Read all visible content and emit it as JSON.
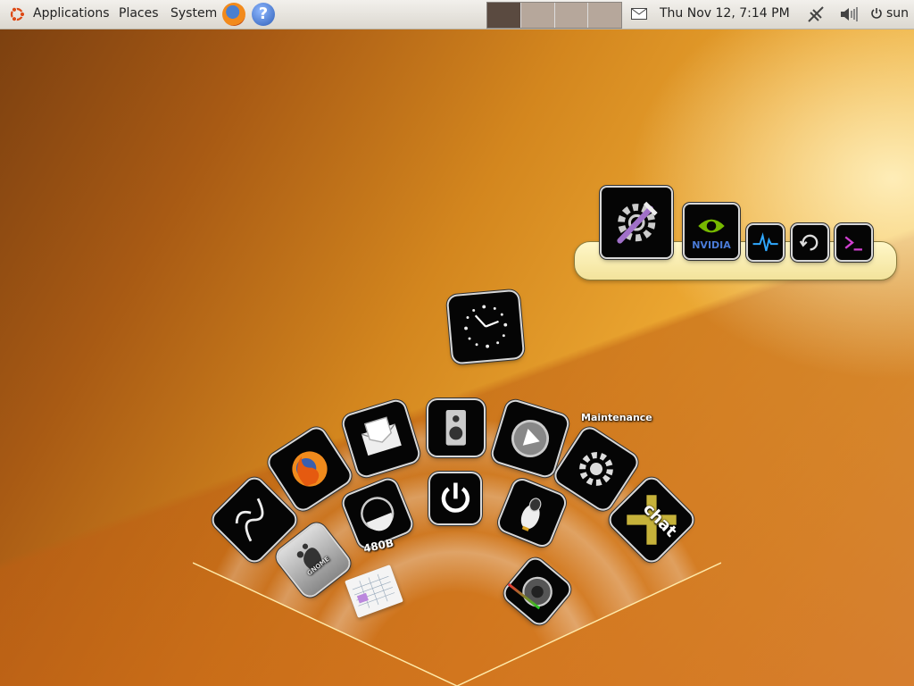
{
  "panel": {
    "menu": [
      "Applications",
      "Places",
      "System"
    ],
    "clock": "Thu Nov 12,  7:14 PM",
    "user": "sun",
    "workspace_count": 4,
    "active_workspace": 1
  },
  "dock": {
    "icons": [
      "system-tools-icon",
      "nvidia-icon",
      "system-monitor-icon",
      "update-icon",
      "terminal-icon"
    ],
    "nvidia_text": "NVIDIA"
  },
  "launcher": {
    "maintenance_label": "Maintenance",
    "disk_label": "480B",
    "chat_label": "chat",
    "gnome_label": "GNOME",
    "icons": [
      "clock-icon",
      "sound-icon",
      "mail-icon",
      "play-icon",
      "firefox-icon",
      "settings-icon",
      "xchat-icon",
      "logout-icon",
      "disk-icon",
      "power-icon",
      "penguin-icon",
      "gnome-icon",
      "speaker-icon",
      "spreadsheet-icon"
    ]
  },
  "colors": {
    "panel_bg": "#e8e5df",
    "wallpaper_dark": "#7a3f10",
    "wallpaper_light": "#f7d36c",
    "dock_bg": "#f7eab0",
    "tile_bg": "#050505"
  }
}
